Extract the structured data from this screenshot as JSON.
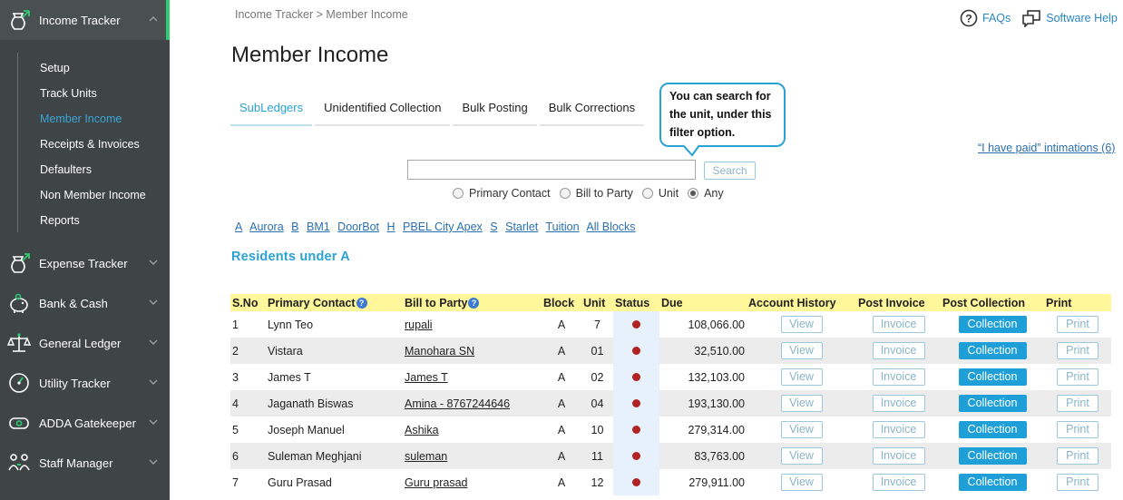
{
  "sidebar": {
    "main_items": [
      {
        "label": "Income Tracker",
        "icon": "money-bag-icon"
      },
      {
        "label": "Expense Tracker",
        "icon": "money-bag-out-icon"
      },
      {
        "label": "Bank & Cash",
        "icon": "piggy-bank-icon"
      },
      {
        "label": "General Ledger",
        "icon": "scales-icon"
      },
      {
        "label": "Utility Tracker",
        "icon": "meter-icon"
      },
      {
        "label": "ADDA Gatekeeper",
        "icon": "gatekeeper-icon"
      },
      {
        "label": "Staff Manager",
        "icon": "staff-icon"
      }
    ],
    "sub_items": [
      "Setup",
      "Track Units",
      "Member Income",
      "Receipts & Invoices",
      "Defaulters",
      "Non Member Income",
      "Reports"
    ]
  },
  "breadcrumb": {
    "root": "Income Tracker",
    "sep": ">",
    "current": "Member Income"
  },
  "header": {
    "faqs": "FAQs",
    "software_help": "Software Help"
  },
  "page_title": "Member Income",
  "tabs": [
    "SubLedgers",
    "Unidentified Collection",
    "Bulk Posting",
    "Bulk Corrections"
  ],
  "callout": {
    "line1": "You can search for",
    "line2": "the unit, under this",
    "line3": "filter option."
  },
  "paid_link": "“I have paid” intimations (6)",
  "search": {
    "value": "",
    "button": "Search"
  },
  "filters": [
    {
      "label": "Primary Contact",
      "checked": false
    },
    {
      "label": "Bill to Party",
      "checked": false
    },
    {
      "label": "Unit",
      "checked": false
    },
    {
      "label": "Any",
      "checked": true
    }
  ],
  "blocks": [
    "A",
    "Aurora",
    "B",
    "BM1",
    "DoorBot",
    "H",
    "PBEL City Apex",
    "S",
    "Starlet",
    "Tuition",
    "All Blocks"
  ],
  "section_title": "Residents under A",
  "table": {
    "headers": [
      "S.No",
      "Primary Contact",
      "Bill to Party",
      "Block",
      "Unit",
      "Status",
      "Due",
      "Account History",
      "Post Invoice",
      "Post Collection",
      "Print"
    ],
    "button_labels": {
      "view": "View",
      "invoice": "Invoice",
      "collection": "Collection",
      "print": "Print"
    },
    "rows": [
      {
        "sno": "1",
        "contact": "Lynn Teo",
        "party": "rupali",
        "block": "A",
        "unit": "7",
        "due": "108,066.00"
      },
      {
        "sno": "2",
        "contact": "Vistara",
        "party": "Manohara SN",
        "block": "A",
        "unit": "01",
        "due": "32,510.00"
      },
      {
        "sno": "3",
        "contact": "James T",
        "party": "James T",
        "block": "A",
        "unit": "02",
        "due": "132,103.00"
      },
      {
        "sno": "4",
        "contact": "Jaganath Biswas",
        "party": "Amina - 8767244646",
        "block": "A",
        "unit": "04",
        "due": "193,130.00"
      },
      {
        "sno": "5",
        "contact": "Joseph Manuel",
        "party": "Ashika",
        "block": "A",
        "unit": "10",
        "due": "279,314.00"
      },
      {
        "sno": "6",
        "contact": "Suleman Meghjani",
        "party": "suleman",
        "block": "A",
        "unit": "11",
        "due": "83,763.00"
      },
      {
        "sno": "7",
        "contact": "Guru Prasad",
        "party": "Guru prasad",
        "block": "A",
        "unit": "12",
        "due": "279,911.00"
      }
    ]
  },
  "colors": {
    "accent": "#2aa2d4",
    "sidebar_bg": "#3f4446",
    "active_bar": "#2ecc71",
    "header_row": "#fff799",
    "status_dot": "#b22222"
  }
}
